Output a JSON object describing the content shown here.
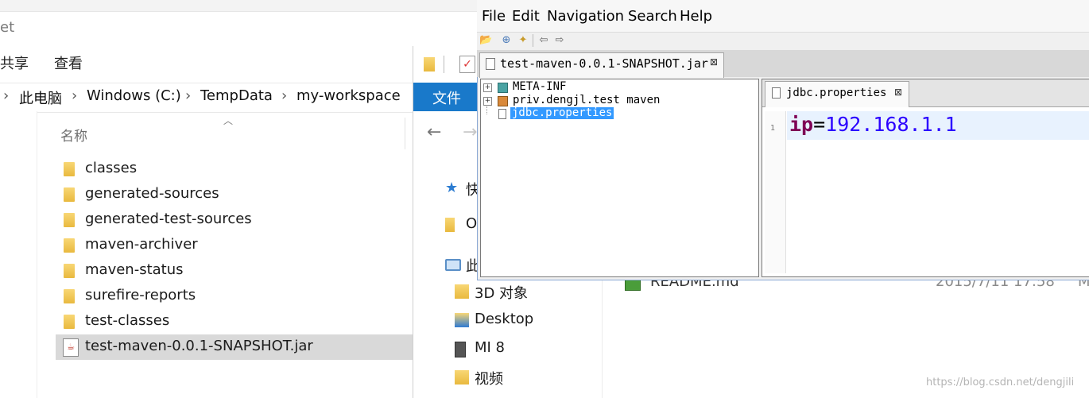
{
  "explorer_back": {
    "title_fragment": "et",
    "ribbon_tabs": [
      "共享",
      "查看"
    ],
    "breadcrumb": [
      "此电脑",
      "Windows (C:)",
      "TempData",
      "my-workspace"
    ],
    "column_header": "名称",
    "files": [
      {
        "name": "classes",
        "type": "folder"
      },
      {
        "name": "generated-sources",
        "type": "folder"
      },
      {
        "name": "generated-test-sources",
        "type": "folder"
      },
      {
        "name": "maven-archiver",
        "type": "folder"
      },
      {
        "name": "maven-status",
        "type": "folder"
      },
      {
        "name": "surefire-reports",
        "type": "folder"
      },
      {
        "name": "test-classes",
        "type": "folder"
      },
      {
        "name": "test-maven-0.0.1-SNAPSHOT.jar",
        "type": "jar",
        "selected": true
      }
    ]
  },
  "explorer_mid": {
    "ribbon_tab": "文件",
    "nav": [
      {
        "label": "快",
        "icon": "star-icon"
      },
      {
        "label": "O",
        "icon": "folder-icon"
      },
      {
        "label": "此",
        "icon": "computer-icon"
      }
    ],
    "sub_items": [
      {
        "label": "3D 对象",
        "icon": "3d-objects-icon"
      },
      {
        "label": "Desktop",
        "icon": "desktop-icon"
      },
      {
        "label": "MI 8",
        "icon": "phone-icon"
      },
      {
        "label": "视频",
        "icon": "video-icon"
      }
    ],
    "readme": {
      "name": "README.md",
      "date": "2015/7/11 17:58",
      "extra": "M"
    }
  },
  "jd": {
    "menu": [
      "File",
      "Edit",
      "Navigation",
      "Search",
      "Help"
    ],
    "tab": "test-maven-0.0.1-SNAPSHOT.jar",
    "tab_close": "⊠",
    "tree": [
      {
        "label": "META-INF",
        "expander": "+",
        "icon": "package-icon"
      },
      {
        "label": "priv.dengjl.test maven",
        "expander": "+",
        "icon": "package-icon"
      },
      {
        "label": "jdbc.properties",
        "expander": "",
        "icon": "file-icon",
        "selected": true
      }
    ],
    "editor_tab": "jdbc.properties",
    "editor_close": "⊠",
    "line_number": "1",
    "code": {
      "key": "ip",
      "eq": "=",
      "value": "192.168.1.1"
    }
  },
  "watermark": "https://blog.csdn.net/dengjili"
}
